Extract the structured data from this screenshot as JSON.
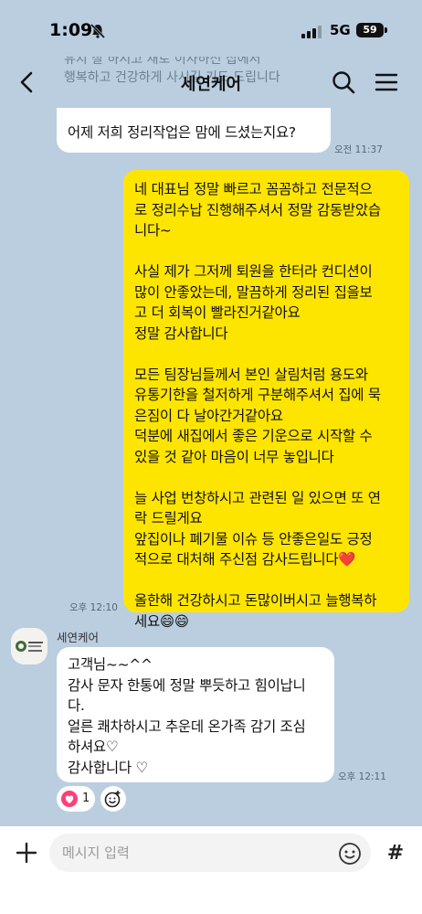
{
  "status_bar": {
    "time": "1:09",
    "network": "5G",
    "battery": "59"
  },
  "header": {
    "title": "세연케어",
    "behind_text_1": "유지 잘 하시고 새로 이사하신 집에서",
    "behind_text_2": "행복하고 건강하게 사시길 기도 드립니다"
  },
  "messages": [
    {
      "side": "me",
      "text": "어제 저희 정리작업은 맘에 드셨는지요?",
      "time": "오전 11:37"
    },
    {
      "side": "me-yellow",
      "text": "네 대표님 정말 빠르고 꼼꼼하고 전문적으\n로 정리수납 진행해주셔서 정말 감동받았습\n니다~\n\n사실 제가 그저께 퇴원을 한터라 컨디션이\n많이 안좋았는데, 말끔하게 정리된 집을보\n고 더 회복이 빨라진거같아요\n정말 감사합니다\n\n모든 팀장님들께서 본인 살림처럼 용도와\n유통기한을 철저하게 구분해주셔서 집에 묵\n은짐이 다 날아간거같아요\n덕분에 새집에서 좋은 기운으로 시작할 수\n있을 것 같아 마음이 너무 놓입니다\n\n늘 사업 번창하시고 관련된 일 있으면 또 연\n락 드릴게요\n앞집이나 폐기물 이슈 등 안좋은일도 긍정\n적으로 대처해 주신점 감사드립니다❤️\n\n올한해 건강하시고 돈많이버시고 늘행복하\n세요😄😄",
      "time": "오후 12:10"
    },
    {
      "side": "other",
      "sender": "세연케어",
      "text": "고객님~~^^\n감사 문자 한통에 정말 뿌듯하고 힘이납니\n다.\n얼른 쾌차하시고 추운데 온가족 감기 조심\n하셔요♡\n감사합니다 ♡",
      "time": "오후 12:11"
    }
  ],
  "reaction": {
    "icon": "heart-icon",
    "count": "1"
  },
  "input": {
    "placeholder": "메시지 입력"
  },
  "colors": {
    "background": "#bacee0",
    "my_bubble": "#fee500",
    "other_bubble": "#ffffff"
  }
}
